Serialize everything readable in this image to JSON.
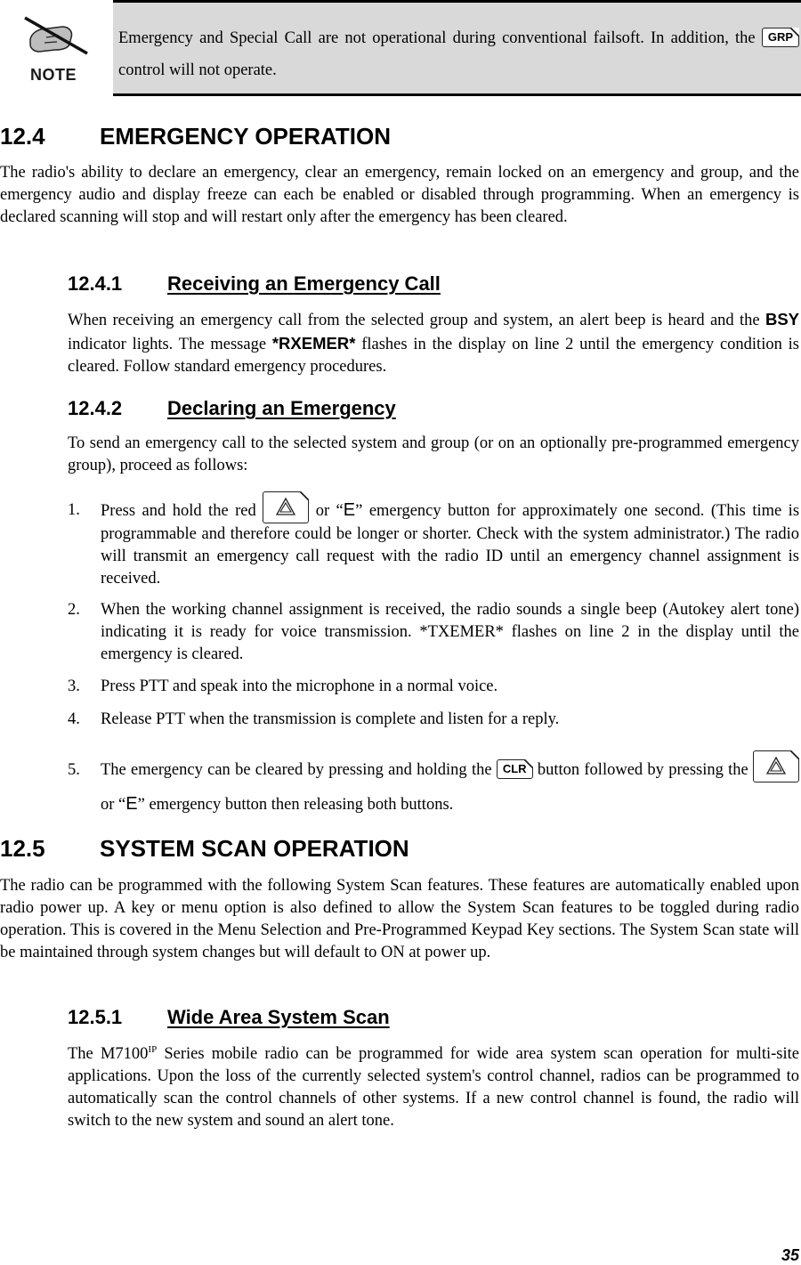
{
  "note": {
    "label": "NOTE",
    "icon": "hand-writing-pencil-icon",
    "text_before_key": "Emergency and Special Call are not operational during conventional failsoft. In addition, the",
    "key_label": "GRP",
    "text_after_key": "control will not operate."
  },
  "section_12_4": {
    "number": "12.4",
    "title": "EMERGENCY OPERATION",
    "body": "The radio's ability to declare an emergency, clear an emergency, remain locked on an emergency and group, and the emergency audio and display freeze can each be enabled or disabled through programming. When an emergency is declared scanning will stop and will restart only after the emergency has been cleared."
  },
  "section_12_4_1": {
    "number": "12.4.1",
    "title": "Receiving an Emergency Call",
    "body_part1": "When receiving an emergency call from the selected group and system, an alert beep is heard and the",
    "bold1": "BSY",
    "body_part2": "indicator lights.  The message",
    "bold2": "*RXEMER*",
    "body_part3": "flashes in the display on line 2 until the emergency condition is cleared. Follow standard emergency procedures."
  },
  "section_12_4_2": {
    "number": "12.4.2",
    "title": "Declaring an Emergency",
    "intro": "To send an emergency call to the selected system and group (or on an optionally pre-programmed emergency group), proceed as follows:",
    "steps": [
      {
        "num": "1.",
        "before_key": "Press and hold the red",
        "e_prefix": "or “",
        "e_glyph": "E",
        "e_suffix": "”",
        "after_key": "emergency button for approximately one second. (This time is programmable and therefore could be longer or shorter. Check with the system administrator.) The radio will transmit an emergency call request with the radio ID until an emergency channel assignment is received."
      },
      {
        "num": "2.",
        "text": "When the working channel assignment is received, the radio sounds a single beep (Autokey alert tone) indicating it is ready for voice transmission. *TXEMER* flashes on line 2 in the display until the emergency is cleared."
      },
      {
        "num": "3.",
        "text": "Press PTT and speak into the microphone in a normal voice."
      },
      {
        "num": "4.",
        "text": "Release PTT when the transmission is complete and listen for a reply."
      },
      {
        "num": "5.",
        "before_clr": "The emergency can be cleared by pressing and holding the",
        "clr_label": "CLR",
        "after_clr": "button followed by pressing the",
        "e_prefix": "or “",
        "e_glyph": "E",
        "e_suffix": "”",
        "after_key": "emergency button then releasing both buttons."
      }
    ]
  },
  "section_12_5": {
    "number": "12.5",
    "title": "SYSTEM SCAN OPERATION",
    "body": "The radio can be programmed with the following System Scan features. These features are automatically enabled upon radio power up. A key or menu option is also defined to allow the System Scan features to be toggled during radio operation. This is covered in the Menu Selection and Pre-Programmed Keypad Key sections. The System Scan state will be maintained through system changes but will default to ON at power up."
  },
  "section_12_5_1": {
    "number": "12.5.1",
    "title": "Wide Area System Scan",
    "model": "M7100",
    "model_sup": "IP",
    "body_before": "The",
    "body_after": "Series mobile radio can be programmed for wide area system scan operation for multi-site applications. Upon the loss of the currently selected system's control channel, radios can be programmed to automatically scan the control channels of other systems. If a new control channel is found, the radio will switch to the new system and sound an alert tone."
  },
  "footer": {
    "page_number": "35"
  }
}
